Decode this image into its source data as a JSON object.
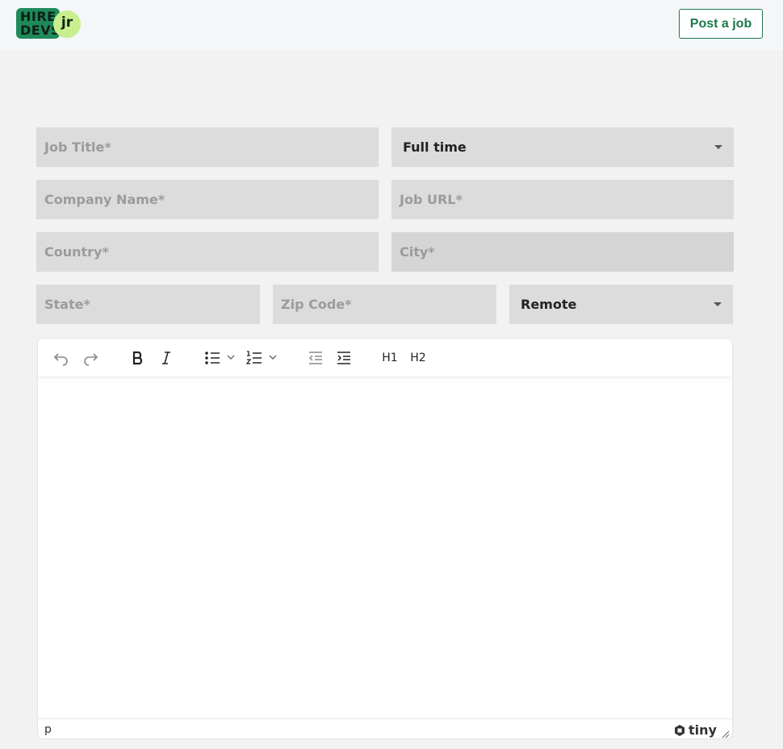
{
  "header": {
    "logo": {
      "line1": "HIRE",
      "line2": "DEVS",
      "badge": "jr",
      "brand_color": "#1e8a5a",
      "badge_color": "#c7ef8d"
    },
    "post_job_label": "Post a job",
    "accent": "#1a7a4c"
  },
  "form": {
    "job_title_placeholder": "Job Title*",
    "employment_type": "Full time",
    "company_name_placeholder": "Company Name*",
    "job_url_placeholder": "Job URL*",
    "country_placeholder": "Country*",
    "city_placeholder": "City*",
    "state_placeholder": "State*",
    "zip_placeholder": "Zip Code*",
    "work_mode": "Remote"
  },
  "editor": {
    "toolbar": {
      "icons": [
        "undo-icon",
        "redo-icon",
        "bold-icon",
        "italic-icon",
        "bullet-list-icon",
        "numbered-list-icon",
        "outdent-icon",
        "indent-icon"
      ],
      "h1_label": "H1",
      "h2_label": "H2"
    },
    "status_path": "p",
    "brand": "tiny"
  }
}
